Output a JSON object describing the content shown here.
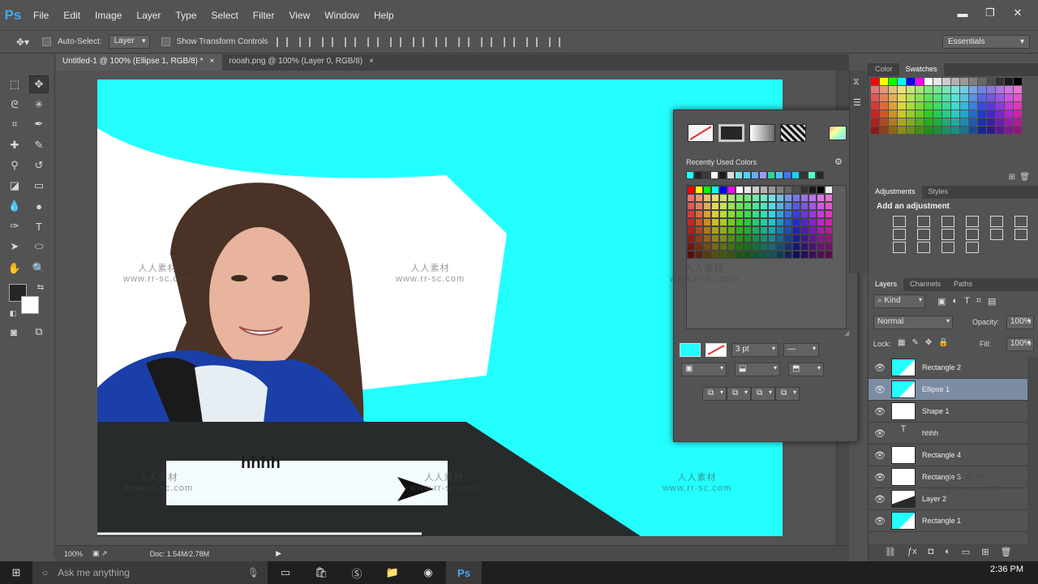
{
  "app": {
    "logo": "Ps"
  },
  "menu": [
    "File",
    "Edit",
    "Image",
    "Layer",
    "Type",
    "Select",
    "Filter",
    "View",
    "Window",
    "Help"
  ],
  "options": {
    "auto_select_label": "Auto-Select:",
    "auto_select_value": "Layer",
    "transform_label": "Show Transform Controls",
    "workspace": "Essentials"
  },
  "tabs": [
    {
      "label": "Untitled-1 @ 100% (Ellipse 1, RGB/8) *",
      "close": "×"
    },
    {
      "label": "rooah.png @ 100% (Layer 0, RGB/8)",
      "close": "×"
    }
  ],
  "canvas": {
    "headline": "hhhh",
    "accent": "#23ffff",
    "dark": "#282b2b"
  },
  "status": {
    "zoom": "100%",
    "doc": "Doc: 1.54M/2.78M"
  },
  "popup": {
    "recent_label": "Recently Used Colors",
    "stroke_width": "3 pt",
    "recent_colors": [
      "#23ffff",
      "#222222",
      "#3a3a3a",
      "#ffffff",
      "#1a1a1a",
      "#dddddd",
      "#7be0e0",
      "#55cfff",
      "#66aaff",
      "#9999ff",
      "#2bd4a0",
      "#4bc0ff",
      "#3e77ff",
      "#18d3ff",
      "#333333",
      "#55ffcc",
      "#262626"
    ]
  },
  "panels": {
    "color_tabs": [
      "Color",
      "Swatches"
    ],
    "adj_tabs": [
      "Adjustments",
      "Styles"
    ],
    "adj_title": "Add an adjustment",
    "layer_tabs": [
      "Layers",
      "Channels",
      "Paths"
    ],
    "kind": "Kind",
    "blend": "Normal",
    "opacity_label": "Opacity:",
    "opacity": "100%",
    "lock_label": "Lock:",
    "fill_label": "Fill:",
    "fill": "100%"
  },
  "layers": [
    {
      "name": "Rectangle 2",
      "selected": false,
      "thumb": "cyan"
    },
    {
      "name": "Ellipse 1",
      "selected": true,
      "thumb": "cyan"
    },
    {
      "name": "Shape 1",
      "selected": false,
      "thumb": "white"
    },
    {
      "name": "hhhh",
      "selected": false,
      "thumb": "text"
    },
    {
      "name": "Rectangle 4",
      "selected": false,
      "thumb": "white"
    },
    {
      "name": "Rectangle 3",
      "selected": false,
      "thumb": "white"
    },
    {
      "name": "Layer 2",
      "selected": false,
      "thumb": "dark"
    },
    {
      "name": "Rectangle 1",
      "selected": false,
      "thumb": "cyan"
    }
  ],
  "taskbar": {
    "search_placeholder": "Ask me anything",
    "time": "2:36 PM"
  },
  "watermark": {
    "line1": "人人素材",
    "line2": "www.rr-sc.com"
  }
}
